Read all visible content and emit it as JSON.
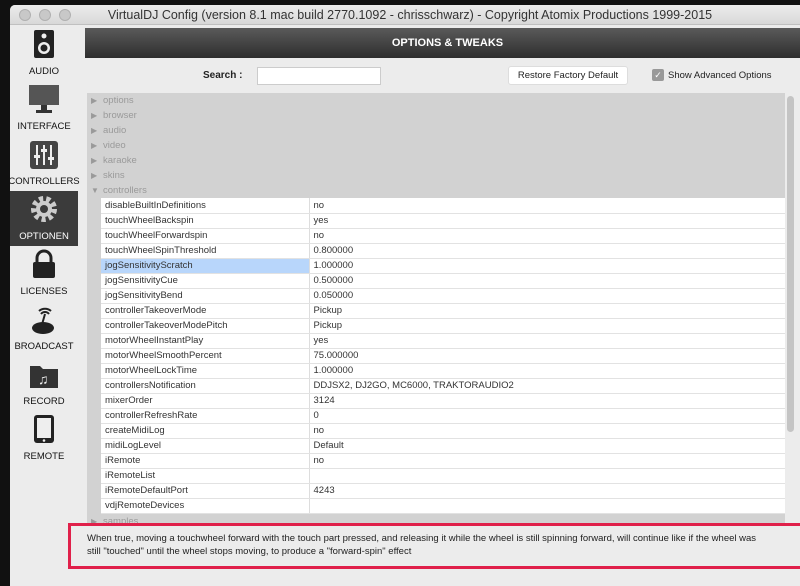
{
  "title": "VirtualDJ Config (version 8.1 mac build 2770.1092 - chrisschwarz) - Copyright Atomix Productions 1999-2015",
  "sidebar": [
    {
      "label": "AUDIO",
      "icon": "speaker-icon"
    },
    {
      "label": "INTERFACE",
      "icon": "monitor-icon"
    },
    {
      "label": "CONTROLLERS",
      "icon": "mixer-icon"
    },
    {
      "label": "OPTIONEN",
      "icon": "gear-icon",
      "selected": true
    },
    {
      "label": "LICENSES",
      "icon": "lock-icon"
    },
    {
      "label": "BROADCAST",
      "icon": "broadcast-icon"
    },
    {
      "label": "RECORD",
      "icon": "music-folder-icon"
    },
    {
      "label": "REMOTE",
      "icon": "tablet-icon"
    }
  ],
  "header": {
    "title": "OPTIONS & TWEAKS"
  },
  "search": {
    "label": "Search :",
    "value": ""
  },
  "restore_label": "Restore Factory Default",
  "advanced": {
    "label": "Show Advanced Options",
    "checked": true
  },
  "categories": [
    "options",
    "browser",
    "audio",
    "video",
    "karaoke",
    "skins"
  ],
  "expanded": "controllers",
  "rows": [
    [
      "disableBuiltInDefinitions",
      "no"
    ],
    [
      "touchWheelBackspin",
      "yes"
    ],
    [
      "touchWheelForwardspin",
      "no"
    ],
    [
      "touchWheelSpinThreshold",
      "0.800000"
    ],
    [
      "jogSensitivityScratch",
      "1.000000"
    ],
    [
      "jogSensitivityCue",
      "0.500000"
    ],
    [
      "jogSensitivityBend",
      "0.050000"
    ],
    [
      "controllerTakeoverMode",
      "Pickup"
    ],
    [
      "controllerTakeoverModePitch",
      "Pickup"
    ],
    [
      "motorWheelInstantPlay",
      "yes"
    ],
    [
      "motorWheelSmoothPercent",
      "75.000000"
    ],
    [
      "motorWheelLockTime",
      "1.000000"
    ],
    [
      "controllersNotification",
      "DDJSX2, DJ2GO, MC6000, TRAKTORAUDIO2"
    ],
    [
      "mixerOrder",
      "3124"
    ],
    [
      "controllerRefreshRate",
      "0"
    ],
    [
      "createMidiLog",
      "no"
    ],
    [
      "midiLogLevel",
      "Default"
    ],
    [
      "iRemote",
      "no"
    ],
    [
      "iRemoteList",
      ""
    ],
    [
      "iRemoteDefaultPort",
      "4243"
    ],
    [
      "vdjRemoteDevices",
      ""
    ]
  ],
  "selected_row": 4,
  "next_category": "samples",
  "description": [
    "When true, moving a touchwheel forward with the touch part pressed, and releasing it while the wheel is still spinning forward, will continue like if the wheel was",
    "still \"touched\" until the wheel stops moving, to produce a \"forward-spin\" effect"
  ]
}
